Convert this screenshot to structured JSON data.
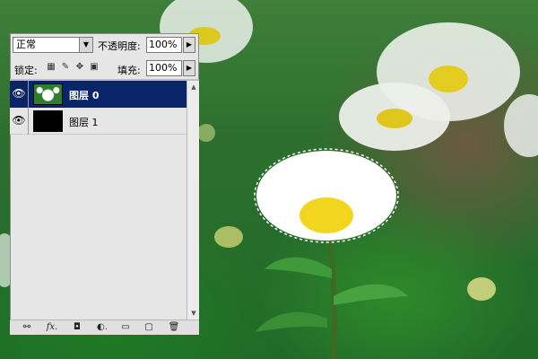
{
  "layers_panel": {
    "blend_mode": "正常",
    "opacity_label": "不透明度:",
    "opacity_value": "100%",
    "lock_label": "锁定:",
    "fill_label": "填充:",
    "fill_value": "100%",
    "layers": [
      {
        "name": "图层 0",
        "selected": true
      },
      {
        "name": "图层 1",
        "selected": false
      }
    ]
  },
  "icons": {
    "eye": "eye-icon",
    "lock_transparent": "lock-transparent-icon",
    "lock_pixels": "brush-icon",
    "lock_position": "move-icon",
    "lock_all": "lock-icon",
    "link": "link-icon",
    "fx": "fx-icon",
    "mask": "mask-icon",
    "adjustment": "adjustment-icon",
    "group": "folder-icon",
    "new_layer": "new-layer-icon",
    "delete": "trash-icon"
  },
  "colors": {
    "selection": "#0a246a",
    "panel": "#e6e6e6"
  }
}
